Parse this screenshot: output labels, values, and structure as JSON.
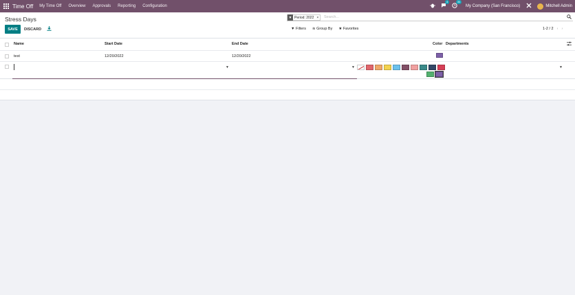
{
  "topbar": {
    "app_name": "Time Off",
    "menus": [
      "My Time Off",
      "Overview",
      "Approvals",
      "Reporting",
      "Configuration"
    ],
    "chat_badge": "4",
    "activity_badge": "34",
    "company": "My Company (San Francisco)",
    "user": "Mitchell Admin"
  },
  "page": {
    "title": "Stress Days"
  },
  "search": {
    "facet_label": "Period: 2022",
    "facet_close": "×",
    "placeholder": "Search..."
  },
  "actions": {
    "save_label": "SAVE",
    "discard_label": "DISCARD"
  },
  "filters": {
    "filters_label": "Filters",
    "group_by_label": "Group By",
    "favorites_label": "Favorites"
  },
  "pager": {
    "value": "1-2 / 2",
    "prev": "‹",
    "next": "›"
  },
  "table": {
    "headers": {
      "name": "Name",
      "start_date": "Start Date",
      "end_date": "End Date",
      "color": "Color",
      "departments": "Departments"
    },
    "rows": [
      {
        "name": "test",
        "start_date": "12/20/2022",
        "end_date": "12/20/2022",
        "color": "#7d60a8"
      }
    ],
    "edit_row": {
      "name": "",
      "start_date": "",
      "end_date": "",
      "departments": ""
    }
  },
  "color_picker": {
    "row1": [
      "none",
      "#e0656b",
      "#efa868",
      "#f3d24e",
      "#6cc1ed",
      "#824f67",
      "#f0a0a0",
      "#3a8a8a",
      "#334766",
      "#d63e56"
    ],
    "row2": [
      "#52b06f",
      "#7d60a8"
    ],
    "selected": "#7d60a8"
  }
}
